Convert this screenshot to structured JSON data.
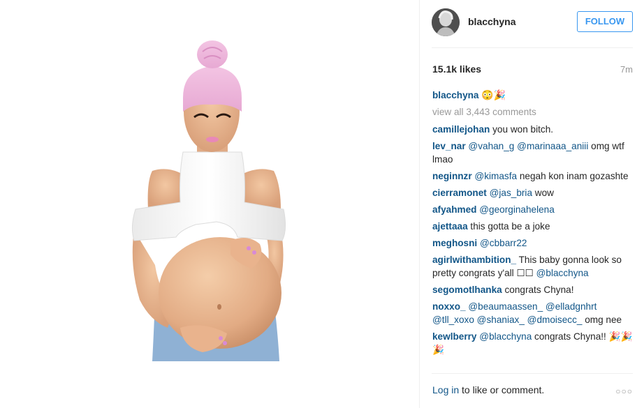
{
  "post": {
    "username": "blacchyna",
    "follow_label": "FOLLOW",
    "likes": "15.1k likes",
    "timestamp": "7m",
    "caption_user": "blacchyna",
    "caption_emoji": "😳🎉",
    "view_all": "view all 3,443 comments"
  },
  "comments": [
    {
      "user": "camillejohan",
      "text": " you won bitch."
    },
    {
      "user": "lev_nar",
      "mention": "@vahan_g @marinaaa_aniii",
      "text": " omg wtf lmao"
    },
    {
      "user": "neginnzr",
      "mention": "@kimasfa",
      "text": " negah kon inam gozashte"
    },
    {
      "user": "cierramonet",
      "mention": "@jas_bria",
      "text": " wow"
    },
    {
      "user": "afyahmed",
      "mention": "@georginahelena",
      "text": ""
    },
    {
      "user": "ajettaaa",
      "text": " this gotta be a joke"
    },
    {
      "user": "meghosni",
      "mention": "@cbbarr22",
      "text": ""
    },
    {
      "user": "agirlwithambition_",
      "text": " This baby gonna look so pretty congrats y'all ☐☐ ",
      "mention2": "@blacchyna"
    },
    {
      "user": "segomotlhanka",
      "text": " congrats Chyna!"
    },
    {
      "user": "noxxo_",
      "mention": "@beaumaassen_ @elladgnhrt @tll_xoxo @shaniax_ @dmoisecc_",
      "text": " omg nee"
    },
    {
      "user": "kewlberry",
      "mention": "@blacchyna",
      "text": " congrats Chyna!! 🎉🎉🎉"
    }
  ],
  "footer": {
    "login_link": "Log in",
    "login_text": " to like or comment.",
    "more": "○○○"
  },
  "colors": {
    "accent": "#3897f0",
    "username": "#125688",
    "muted": "#999999"
  },
  "icons": {
    "more": "more-options-icon",
    "avatar": "profile-avatar"
  }
}
